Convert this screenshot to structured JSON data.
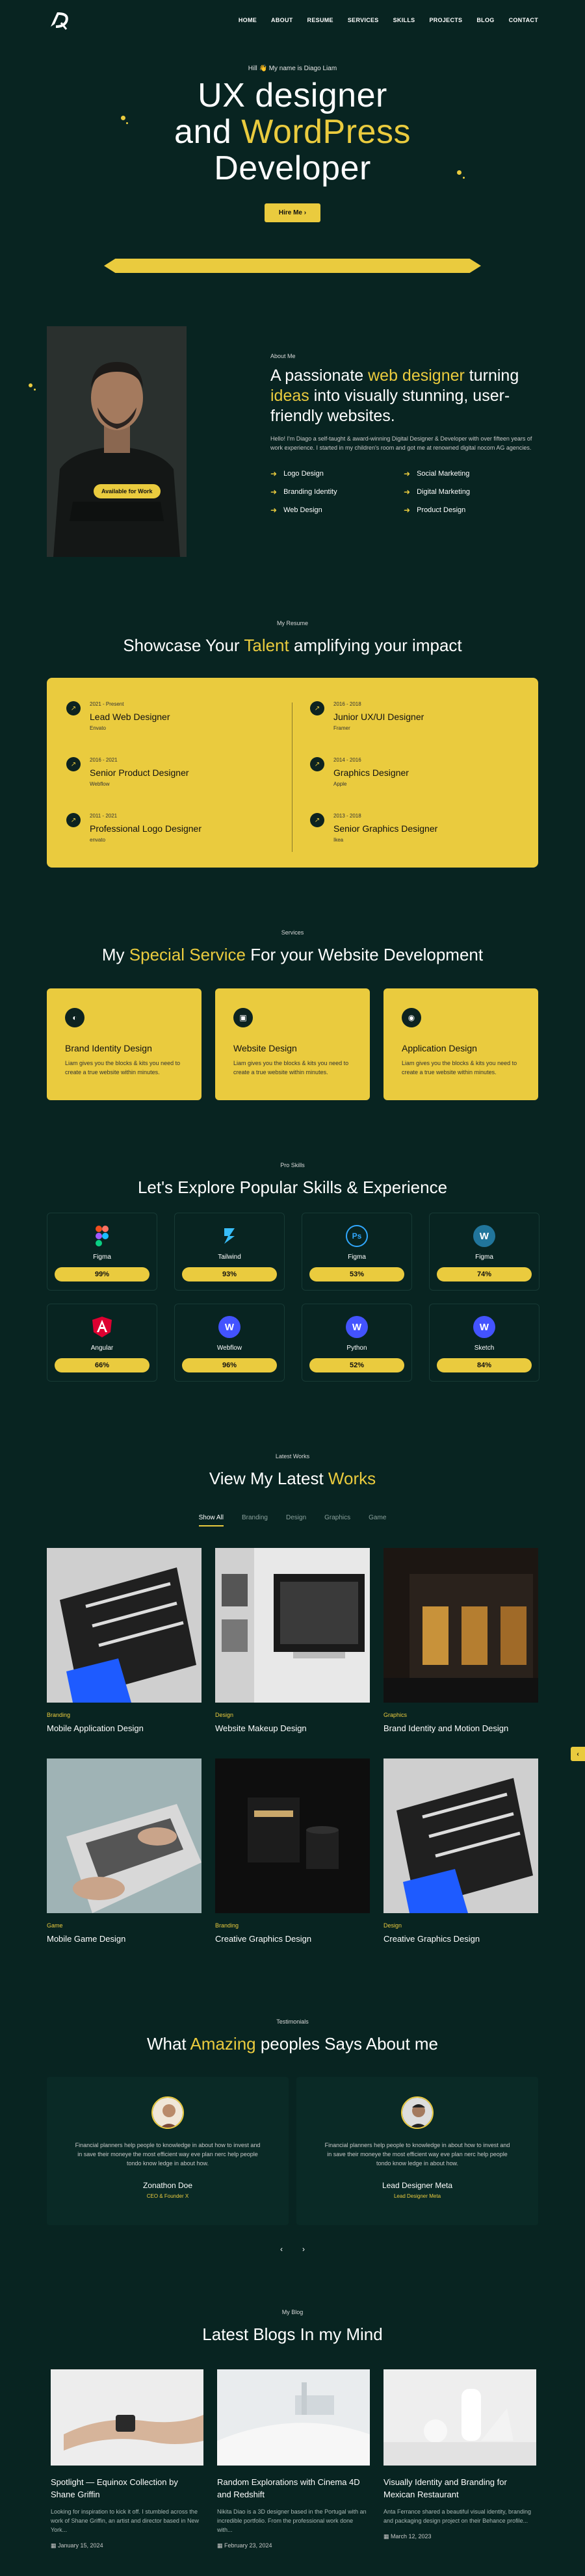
{
  "nav": {
    "logo_text": "D",
    "menu": [
      "HOME",
      "ABOUT",
      "RESUME",
      "SERVICES",
      "SKILLS",
      "PROJECTS",
      "BLOG",
      "CONTACT"
    ]
  },
  "hero": {
    "greeting": "Hill 👋 My name is Diago Liam",
    "title_line1": "UX designer",
    "title_and": "and",
    "title_highlight": "WordPress",
    "title_line3": "Developer",
    "cta": "Hire Me ›"
  },
  "about": {
    "badge": "Available for Work",
    "label": "About Me",
    "heading_part1": "A passionate",
    "heading_highlight1": "web designer",
    "heading_part2": "turning",
    "heading_highlight2": "ideas",
    "heading_part3": "into visually stunning, user-friendly websites.",
    "paragraph": "Hello! I'm Diago a self-taught & award-winning Digital Designer & Developer with over fifteen years of work experience. I started in my children's room and got me at renowned digital nocom AG agencies.",
    "skills": [
      "Logo Design",
      "Social Marketing",
      "Branding Identity",
      "Digital Marketing",
      "Web Design",
      "Product Design"
    ]
  },
  "resume": {
    "label": "My Resume",
    "title_part1": "Showcase Your",
    "title_highlight": "Talent",
    "title_part2": "amplifying your impact",
    "items": [
      {
        "date": "2021 - Present",
        "title": "Lead Web Designer",
        "org": "Envato"
      },
      {
        "date": "2016 - 2018",
        "title": "Junior UX/UI Designer",
        "org": "Framer"
      },
      {
        "date": "2016 - 2021",
        "title": "Senior Product Designer",
        "org": "Webflow"
      },
      {
        "date": "2014 - 2016",
        "title": "Graphics Designer",
        "org": "Apple"
      },
      {
        "date": "2011 - 2021",
        "title": "Professional Logo Designer",
        "org": "envato"
      },
      {
        "date": "2013 - 2018",
        "title": "Senior Graphics Designer",
        "org": "Ikea"
      }
    ]
  },
  "services": {
    "label": "Services",
    "title_part1": "My",
    "title_highlight": "Special Service",
    "title_part2": "For your Website Development",
    "items": [
      {
        "title": "Brand Identity Design",
        "desc": "Liam gives you the blocks & kits you need to create a true website within minutes.",
        "icon": "brand-icon"
      },
      {
        "title": "Website Design",
        "desc": "Liam gives you the blocks & kits you need to create a true website within minutes.",
        "icon": "web-icon"
      },
      {
        "title": "Application Design",
        "desc": "Liam gives you the blocks & kits you need to create a true website within minutes.",
        "icon": "app-icon"
      }
    ]
  },
  "skills": {
    "label": "Pro Skills",
    "title": "Let's Explore Popular Skills & Experience",
    "items": [
      {
        "name": "Figma",
        "pct": "99%",
        "icon": "figma-icon",
        "color": "#F24E1E"
      },
      {
        "name": "Tailwind",
        "pct": "93%",
        "icon": "tailwind-icon",
        "color": "#38BDF8"
      },
      {
        "name": "Figma",
        "pct": "53%",
        "icon": "photoshop-icon",
        "color": "#31A8FF"
      },
      {
        "name": "Figma",
        "pct": "74%",
        "icon": "wordpress-icon",
        "color": "#21759B"
      },
      {
        "name": "Angular",
        "pct": "66%",
        "icon": "angular-icon",
        "color": "#DD0031"
      },
      {
        "name": "Webflow",
        "pct": "96%",
        "icon": "webflow-icon",
        "color": "#4353FF"
      },
      {
        "name": "Python",
        "pct": "52%",
        "icon": "python-icon",
        "color": "#4353FF"
      },
      {
        "name": "Sketch",
        "pct": "84%",
        "icon": "sketch-icon",
        "color": "#4353FF"
      }
    ]
  },
  "works": {
    "label": "Latest Works",
    "title_part1": "View My Latest",
    "title_highlight": "Works",
    "filters": [
      "Show All",
      "Branding",
      "Design",
      "Graphics",
      "Game"
    ],
    "items": [
      {
        "category": "Branding",
        "title": "Mobile Application Design"
      },
      {
        "category": "Design",
        "title": "Website Makeup Design"
      },
      {
        "category": "Graphics",
        "title": "Brand Identity and Motion Design"
      },
      {
        "category": "Game",
        "title": "Mobile Game Design"
      },
      {
        "category": "Branding",
        "title": "Creative Graphics Design"
      },
      {
        "category": "Design",
        "title": "Creative Graphics Design"
      }
    ],
    "side_tab": "‹"
  },
  "testimonials": {
    "label": "Testimonials",
    "title_part1": "What",
    "title_highlight": "Amazing",
    "title_part2": "peoples Says About me",
    "items": [
      {
        "quote": "Financial planners help people to knowledge in about how to invest and in save their moneye the most efficient way eve plan nerc help people tondo know ledge in about how.",
        "name": "Zonathon Doe",
        "role": "CEO & Founder X"
      },
      {
        "quote": "Financial planners help people to knowledge in about how to invest and in save their moneye the most efficient way eve plan nerc help people tondo know ledge in about how.",
        "name": "Lead Designer Meta",
        "role": "Lead Designer Meta"
      }
    ],
    "prev": "‹",
    "next": "›"
  },
  "blog": {
    "label": "My Blog",
    "title": "Latest Blogs In my Mind",
    "items": [
      {
        "title": "Spotlight — Equinox Collection by Shane Griffin",
        "excerpt": "Looking for inspiration to kick it off. I stumbled across the work of Shane Griffin, an artist and director based in New York...",
        "date": "January 15, 2024"
      },
      {
        "title": "Random Explorations with Cinema 4D and Redshift",
        "excerpt": "Nikita Diao is a 3D designer based in the Portugal with an incredible portfolio. From the professional work done with...",
        "date": "February 23, 2024"
      },
      {
        "title": "Visually Identity and Branding for Mexican Restaurant",
        "excerpt": "Anta Ferrance shared a beautiful visual identity, branding and packaging design project on their Behance profile...",
        "date": "March 12, 2023"
      }
    ]
  },
  "colors": {
    "accent": "#EACB3E",
    "background": "#082421"
  }
}
